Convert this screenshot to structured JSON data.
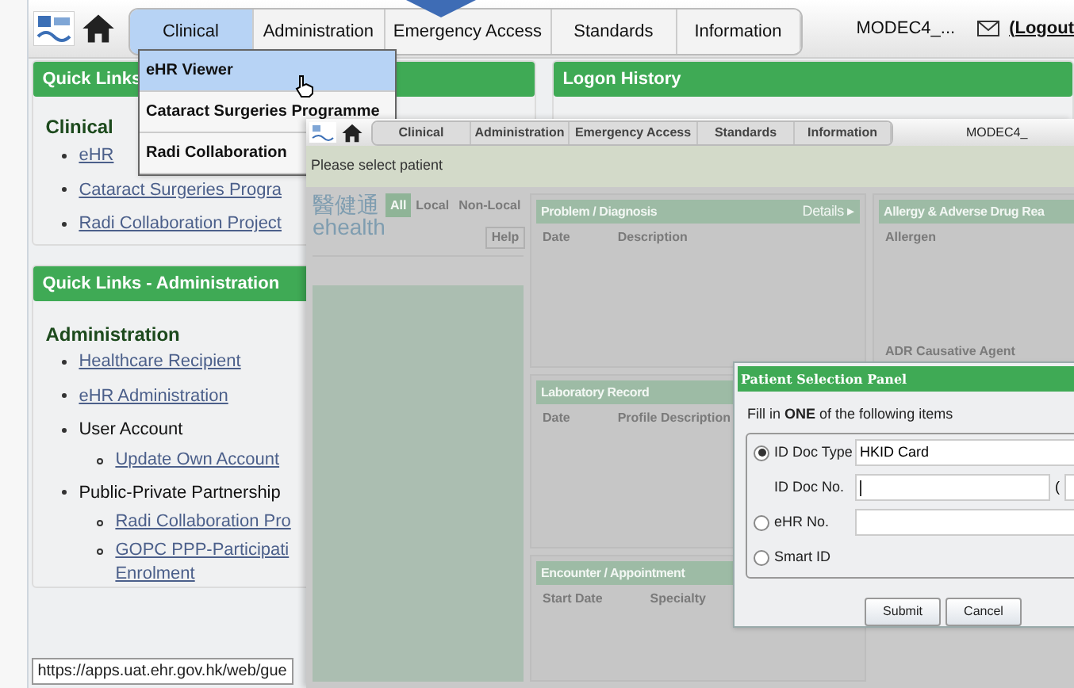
{
  "nav": {
    "tabs": [
      {
        "label": "Clinical",
        "selected": true
      },
      {
        "label": "Administration",
        "selected": false
      },
      {
        "label": "Emergency Access",
        "selected": false
      },
      {
        "label": "Standards",
        "selected": false
      },
      {
        "label": "Information",
        "selected": false
      }
    ],
    "user": "MODEC4_...",
    "logout": "(Logout"
  },
  "dropdown": {
    "items": [
      {
        "label": "eHR Viewer",
        "selected": true
      },
      {
        "label": "Cataract Surgeries Programme",
        "selected": false
      },
      {
        "label": "Radi Collaboration",
        "selected": false
      }
    ]
  },
  "clinical_panel": {
    "header": "Quick Links",
    "heading": "Clinical",
    "links": [
      "eHR",
      "Cataract Surgeries Progra",
      "Radi Collaboration Project"
    ]
  },
  "admin_panel": {
    "header": "Quick Links - Administration",
    "heading": "Administration",
    "items": [
      {
        "label": "Healthcare Recipient",
        "kind": "link"
      },
      {
        "label": "eHR Administration",
        "kind": "link"
      },
      {
        "label": "User Account",
        "kind": "group",
        "children": [
          {
            "label": "Update Own Account",
            "kind": "link"
          }
        ]
      },
      {
        "label": "Public-Private Partnership",
        "kind": "group",
        "children": [
          {
            "label": "Radi Collaboration Pro",
            "kind": "link"
          },
          {
            "label": "GOPC PPP-Participati\nEnrolment",
            "kind": "link"
          }
        ]
      }
    ]
  },
  "logon_panel": {
    "header": "Logon History"
  },
  "status_url": "https://apps.uat.ehr.gov.hk/web/gue",
  "viewer": {
    "tabs": [
      {
        "label": "Clinical",
        "selected": false
      },
      {
        "label": "Administration",
        "selected": false
      },
      {
        "label": "Emergency Access",
        "selected": false
      },
      {
        "label": "Standards",
        "selected": false
      },
      {
        "label": "Information",
        "selected": false
      }
    ],
    "user": "MODEC4_",
    "prompt": "Please select patient",
    "logo": {
      "chinese": "醫健通",
      "latin": "ehealth"
    },
    "filters": [
      {
        "label": "All",
        "selected": true
      },
      {
        "label": "Local",
        "selected": false
      },
      {
        "label": "Non-Local",
        "selected": false
      }
    ],
    "help": "Help",
    "problem": {
      "header": "Problem / Diagnosis",
      "details": "Details ▸",
      "columns": [
        "Date",
        "Description"
      ]
    },
    "lab": {
      "header": "Laboratory Record",
      "columns": [
        "Date",
        "Profile Description"
      ]
    },
    "encounter": {
      "header": "Encounter / Appointment",
      "columns": [
        "Start Date",
        "Specialty"
      ]
    },
    "allergy": {
      "header": "Allergy & Adverse Drug Rea",
      "columns": [
        "Allergen",
        "ADR Causative Agent"
      ]
    }
  },
  "modal": {
    "title": "Patient Selection Panel",
    "instruction": "Fill in **ONE** of the following items",
    "rows": [
      {
        "kind": "select",
        "label": "ID Doc Type",
        "checked": true,
        "value": "HKID Card"
      },
      {
        "kind": "docno",
        "label": "ID Doc No.",
        "paren": "("
      },
      {
        "kind": "text",
        "label": "eHR No.",
        "checked": false
      },
      {
        "kind": "plain",
        "label": "Smart ID",
        "checked": false
      }
    ],
    "buttons": [
      "Submit",
      "Cancel"
    ]
  }
}
